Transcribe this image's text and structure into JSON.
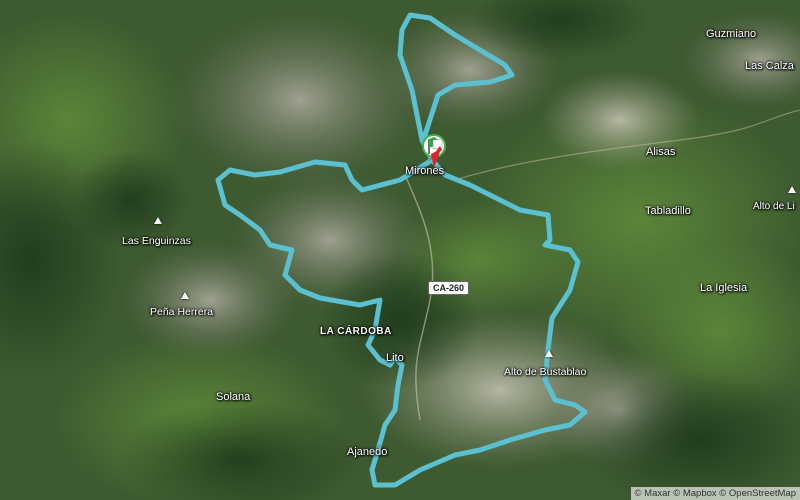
{
  "map": {
    "style": "satellite",
    "route_color": "#5bc0d0",
    "marker_colors": {
      "flag_red": "#e0202a",
      "flag_green": "#2aa84a",
      "ring": "#3cb44a"
    }
  },
  "places": [
    {
      "id": "guzmiano",
      "label": "Guzmiano",
      "kind": "village"
    },
    {
      "id": "las-calzadas",
      "label": "Las Calza",
      "kind": "village"
    },
    {
      "id": "alisas",
      "label": "Alisas",
      "kind": "village"
    },
    {
      "id": "tabladillo",
      "label": "Tabladillo",
      "kind": "village"
    },
    {
      "id": "alto-de-li",
      "label": "Alto de Li",
      "kind": "peak"
    },
    {
      "id": "las-enguinzas",
      "label": "Las Enguinzas",
      "kind": "peak"
    },
    {
      "id": "pena-herrera",
      "label": "Peña Herrera",
      "kind": "peak"
    },
    {
      "id": "la-iglesia",
      "label": "La Iglesia",
      "kind": "village"
    },
    {
      "id": "la-cardoba",
      "label": "LA CÁRDOBA",
      "kind": "area"
    },
    {
      "id": "lito",
      "label": "Lito",
      "kind": "village"
    },
    {
      "id": "alto-de-bustablao",
      "label": "Alto de Bustablao",
      "kind": "peak"
    },
    {
      "id": "solana",
      "label": "Solana",
      "kind": "village"
    },
    {
      "id": "ajanedo",
      "label": "Ajanedo",
      "kind": "village"
    },
    {
      "id": "mirones",
      "label": "Mirones",
      "kind": "village"
    }
  ],
  "road": {
    "label": "CA-260"
  },
  "attribution": "© Maxar © Mapbox © OpenStreetMap"
}
